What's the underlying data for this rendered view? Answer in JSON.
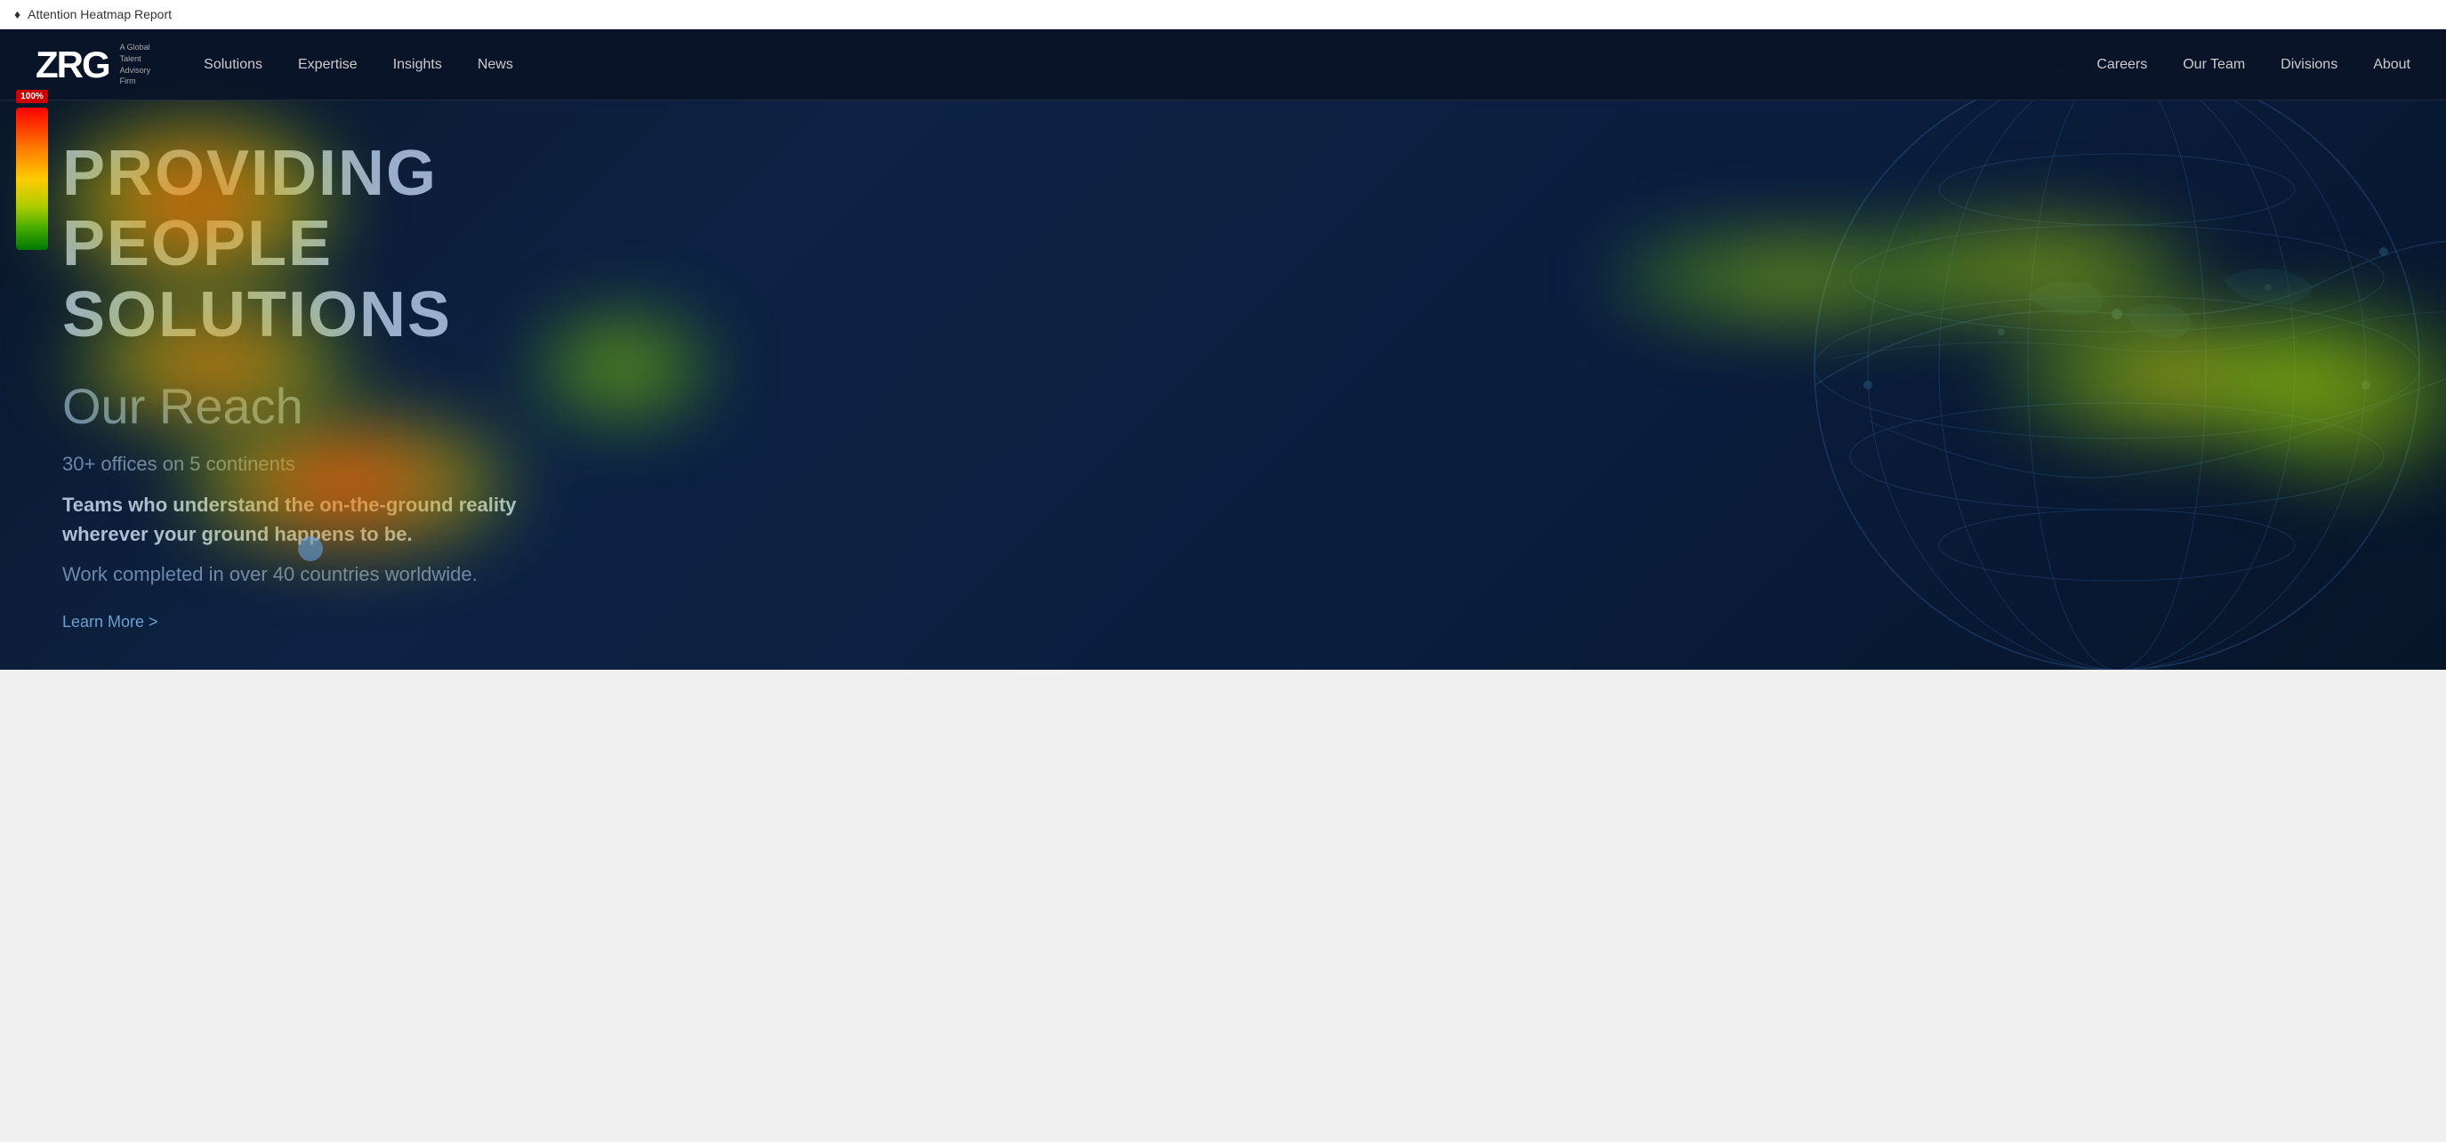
{
  "browser": {
    "icon": "♦",
    "title": "Attention Heatmap Report"
  },
  "navbar": {
    "logo": {
      "text": "ZRG",
      "tagline": "A Global\nTalent\nAdvisory\nFirm"
    },
    "nav_left": [
      {
        "label": "Solutions"
      },
      {
        "label": "Expertise"
      },
      {
        "label": "Insights"
      },
      {
        "label": "News"
      }
    ],
    "nav_right": [
      {
        "label": "Careers"
      },
      {
        "label": "Our Team"
      },
      {
        "label": "Divisions"
      },
      {
        "label": "About"
      }
    ]
  },
  "hero": {
    "title_line1": "PROVIDING",
    "title_line2": "PEOPLE",
    "title_line3": "SOLUTIONS",
    "section_label": "Our Reach",
    "stat1": "30+ offices on 5 continents",
    "desc1": "Teams who understand the on-the-ground reality wherever your ground happens to be.",
    "stat2": "Work completed in over 40 countries worldwide.",
    "learn_more": "Learn More >"
  },
  "heat_scale": {
    "label": "100%"
  }
}
